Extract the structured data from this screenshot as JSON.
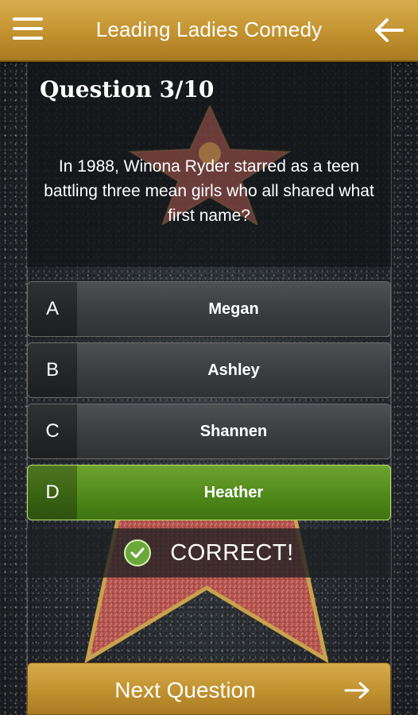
{
  "header": {
    "title": "Leading Ladies Comedy",
    "menu_icon": "hamburger-menu-icon",
    "back_icon": "arrow-left-icon"
  },
  "question": {
    "number": "Question 3/10",
    "text": "In 1988, Winona Ryder starred as a teen battling three mean girls who all shared what first name?"
  },
  "answers": [
    {
      "letter": "A",
      "label": "Megan"
    },
    {
      "letter": "B",
      "label": "Ashley"
    },
    {
      "letter": "C",
      "label": "Shannen"
    },
    {
      "letter": "D",
      "label": "Heather",
      "state": "correct"
    }
  ],
  "result": {
    "text": "CORRECT!",
    "icon": "check-circle-icon"
  },
  "footer": {
    "next_label": "Next Question",
    "next_icon": "arrow-right-icon"
  },
  "colors": {
    "gold": "#c2922f",
    "correct_green": "#5a9624",
    "answer_gray": "#3c3e41"
  }
}
